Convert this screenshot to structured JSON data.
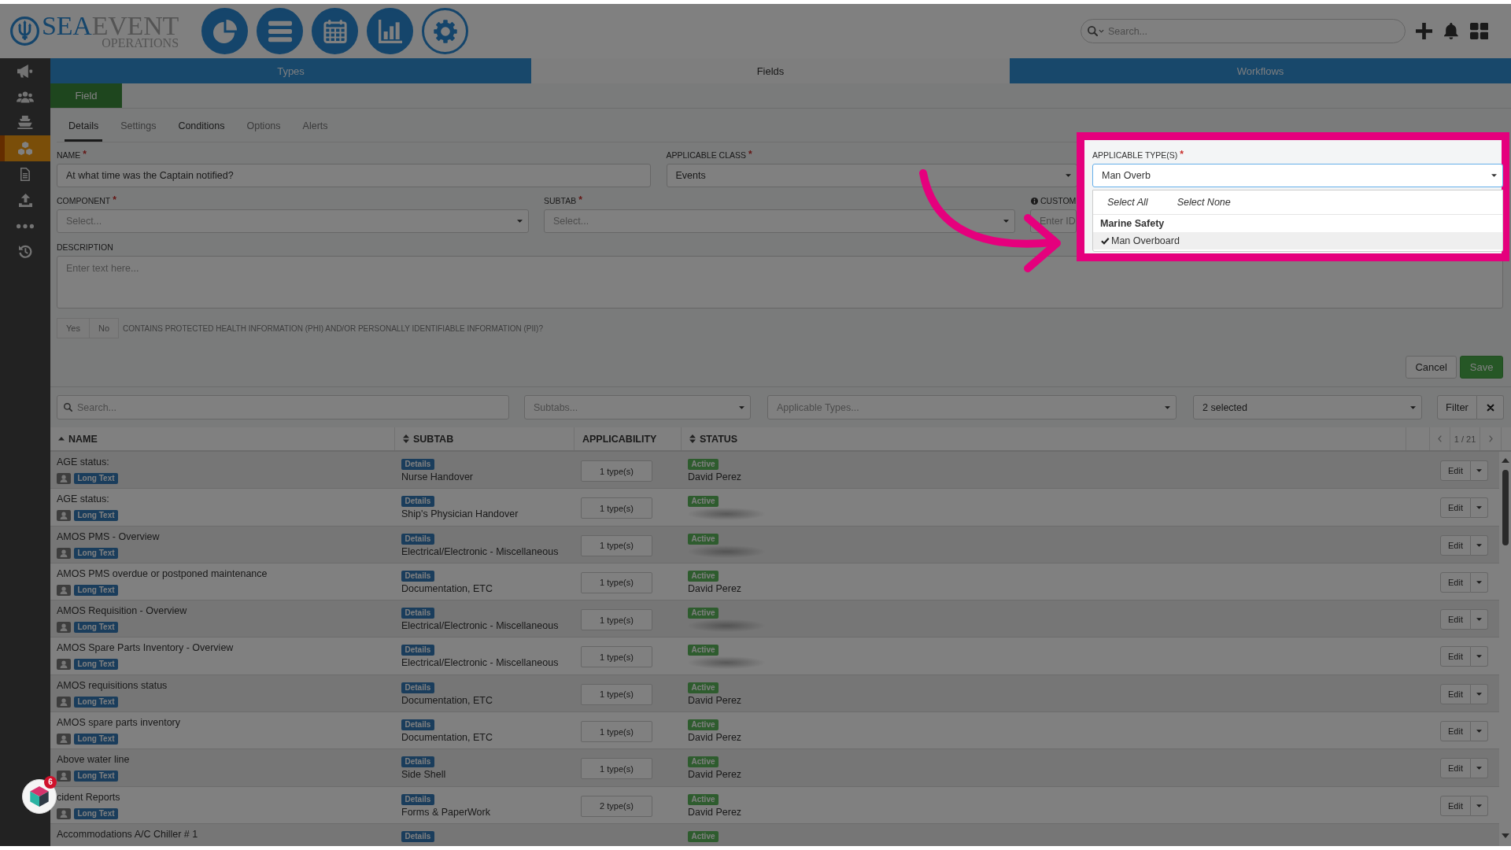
{
  "header": {
    "logo": {
      "words": [
        "SEA",
        "EVENT"
      ],
      "subtitle": "OPERATIONS"
    },
    "nav": [
      {
        "kind": "pie-chart",
        "selected": false
      },
      {
        "kind": "menu",
        "selected": false
      },
      {
        "kind": "calendar",
        "selected": false
      },
      {
        "kind": "bar-chart",
        "selected": false
      },
      {
        "kind": "gear",
        "selected": true
      }
    ],
    "search": {
      "placeholder": "Search..."
    },
    "actions": [
      {
        "kind": "plus"
      },
      {
        "kind": "bell"
      },
      {
        "kind": "grid"
      }
    ]
  },
  "sidebar": {
    "items": [
      {
        "kind": "megaphone",
        "selected": false
      },
      {
        "kind": "users",
        "selected": false
      },
      {
        "kind": "ship",
        "selected": false
      },
      {
        "kind": "cubes",
        "selected": true
      },
      {
        "kind": "document",
        "selected": false
      },
      {
        "kind": "upload",
        "selected": false
      },
      {
        "kind": "ellipsis",
        "selected": false
      },
      {
        "kind": "history",
        "selected": false
      }
    ]
  },
  "main_tabs": [
    {
      "label": "Types",
      "selected": false
    },
    {
      "label": "Fields",
      "selected": true
    },
    {
      "label": "Workflows",
      "selected": false
    }
  ],
  "section_tabs": [
    {
      "label": "Field",
      "selected": true
    }
  ],
  "form": {
    "tabs": [
      {
        "label": "Details",
        "selected": true,
        "disabled": false
      },
      {
        "label": "Settings",
        "selected": false,
        "disabled": true
      },
      {
        "label": "Conditions",
        "selected": false,
        "disabled": false
      },
      {
        "label": "Options",
        "selected": false,
        "disabled": true
      },
      {
        "label": "Alerts",
        "selected": false,
        "disabled": true
      }
    ],
    "name": {
      "label": "NAME",
      "required_mark": "*",
      "value": "At what time was the Captain notified?"
    },
    "applicable_class": {
      "label": "APPLICABLE CLASS",
      "required_mark": "*",
      "value": "Events"
    },
    "applicable_types": {
      "label": "APPLICABLE TYPE(S)",
      "required_mark": "*",
      "value": "Man Overb",
      "focused": true,
      "dropdown": {
        "actions": [
          "Select All",
          "Select None"
        ],
        "groups": [
          {
            "label": "Marine Safety",
            "options": [
              {
                "label": "Man Overboard",
                "selected": true
              }
            ]
          }
        ]
      }
    },
    "component": {
      "label": "COMPONENT",
      "required_mark": "*",
      "placeholder": "Select..."
    },
    "subtab": {
      "label": "SUBTAB",
      "required_mark": "*",
      "placeholder": "Select..."
    },
    "custom_id": {
      "label": "CUSTOM",
      "placeholder": "Enter ID"
    },
    "description": {
      "label": "DESCRIPTION",
      "placeholder": "Enter text here..."
    },
    "phi": {
      "disabled": true,
      "options": [
        {
          "label": "Yes",
          "selected": false
        },
        {
          "label": "No",
          "selected": false
        }
      ],
      "question": "CONTAINS PROTECTED HEALTH INFORMATION (PHI) AND/OR PERSONALLY IDENTIFIABLE INFORMATION (PII)?"
    },
    "buttons": [
      {
        "label": "Cancel",
        "kind": "default"
      },
      {
        "label": "Save",
        "kind": "primary"
      }
    ]
  },
  "filters": {
    "search": {
      "placeholder": "Search..."
    },
    "selects": [
      {
        "placeholder": "Subtabs..."
      },
      {
        "placeholder": "Applicable Types..."
      },
      {
        "value": "2 selected"
      }
    ],
    "filter_button": "Filter"
  },
  "table": {
    "columns": [
      {
        "label": "NAME",
        "kind": "sorted"
      },
      {
        "label": "SUBTAB",
        "kind": "sortable"
      },
      {
        "label": "APPLICABILITY",
        "kind": "plain"
      },
      {
        "label": "STATUS",
        "kind": "sortable"
      }
    ],
    "pagination": "1 / 21",
    "rows": [
      {
        "name": "AGE status:",
        "type_tag": "Long Text",
        "subtab_tag": "Details",
        "subtab": "Nurse Handover",
        "applicability": "1 type(s)",
        "status": "Active",
        "owner": "David Perez",
        "owner_blurred": false,
        "action": "Edit"
      },
      {
        "name": "AGE status:",
        "type_tag": "Long Text",
        "subtab_tag": "Details",
        "subtab": "Ship's Physician Handover",
        "applicability": "1 type(s)",
        "status": "Active",
        "owner_blurred": true,
        "action": "Edit"
      },
      {
        "name": "AMOS PMS - Overview",
        "type_tag": "Long Text",
        "subtab_tag": "Details",
        "subtab": "Electrical/Electronic - Miscellaneous",
        "applicability": "1 type(s)",
        "status": "Active",
        "owner_blurred": true,
        "action": "Edit"
      },
      {
        "name": "AMOS PMS overdue or postponed maintenance",
        "type_tag": "Long Text",
        "subtab_tag": "Details",
        "subtab": "Documentation, ETC",
        "applicability": "1 type(s)",
        "status": "Active",
        "owner": "David Perez",
        "owner_blurred": false,
        "action": "Edit"
      },
      {
        "name": "AMOS Requisition - Overview",
        "type_tag": "Long Text",
        "subtab_tag": "Details",
        "subtab": "Electrical/Electronic - Miscellaneous",
        "applicability": "1 type(s)",
        "status": "Active",
        "owner_blurred": true,
        "action": "Edit"
      },
      {
        "name": "AMOS Spare Parts Inventory - Overview",
        "type_tag": "Long Text",
        "subtab_tag": "Details",
        "subtab": "Electrical/Electronic - Miscellaneous",
        "applicability": "1 type(s)",
        "status": "Active",
        "owner_blurred": true,
        "action": "Edit"
      },
      {
        "name": "AMOS requisitions status",
        "type_tag": "Long Text",
        "subtab_tag": "Details",
        "subtab": "Documentation, ETC",
        "applicability": "1 type(s)",
        "status": "Active",
        "owner": "David Perez",
        "owner_blurred": false,
        "action": "Edit"
      },
      {
        "name": "AMOS spare parts inventory",
        "type_tag": "Long Text",
        "subtab_tag": "Details",
        "subtab": "Documentation, ETC",
        "applicability": "1 type(s)",
        "status": "Active",
        "owner": "David Perez",
        "owner_blurred": false,
        "action": "Edit"
      },
      {
        "name": "Above water line",
        "type_tag": "Long Text",
        "subtab_tag": "Details",
        "subtab": "Side Shell",
        "applicability": "1 type(s)",
        "status": "Active",
        "owner": "David Perez",
        "owner_blurred": false,
        "action": "Edit"
      },
      {
        "name": "cident Reports",
        "type_tag": "Long Text",
        "subtab_tag": "Details",
        "subtab": "Forms & PaperWork",
        "applicability": "2 type(s)",
        "status": "Active",
        "owner": "David Perez",
        "owner_blurred": false,
        "action": "Edit"
      },
      {
        "name": "Accommodations A/C Chiller # 1",
        "subtab_tag": "Details",
        "status": "Active"
      }
    ]
  },
  "floating_widget": {
    "badge": "6"
  }
}
